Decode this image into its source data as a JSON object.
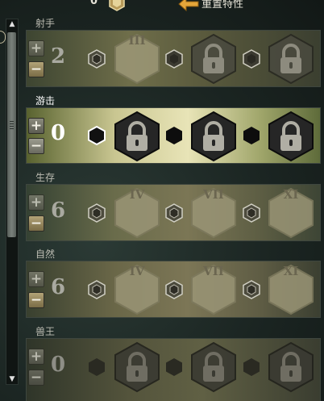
{
  "header": {
    "points_available": "0",
    "reset_label": "重置特性"
  },
  "rows": [
    {
      "title": "射手",
      "points": "2",
      "slots": [
        {
          "kind": "numeral",
          "label": "III"
        },
        {
          "kind": "locked",
          "label": ""
        },
        {
          "kind": "locked",
          "label": ""
        }
      ]
    },
    {
      "title": "游击",
      "points": "0",
      "slots": [
        {
          "kind": "locked",
          "label": ""
        },
        {
          "kind": "locked",
          "label": ""
        },
        {
          "kind": "locked",
          "label": ""
        }
      ]
    },
    {
      "title": "生存",
      "points": "6",
      "slots": [
        {
          "kind": "numeral",
          "label": "IV"
        },
        {
          "kind": "numeral",
          "label": "VII"
        },
        {
          "kind": "numeral",
          "label": "XI"
        }
      ]
    },
    {
      "title": "自然",
      "points": "6",
      "slots": [
        {
          "kind": "numeral",
          "label": "IV"
        },
        {
          "kind": "numeral",
          "label": "VII"
        },
        {
          "kind": "numeral",
          "label": "XI"
        }
      ]
    },
    {
      "title": "兽王",
      "points": "0",
      "slots": [
        {
          "kind": "locked",
          "label": ""
        },
        {
          "kind": "locked",
          "label": ""
        },
        {
          "kind": "locked",
          "label": ""
        }
      ]
    }
  ],
  "icons": {
    "plus": "+",
    "minus": "−",
    "scroll_up": "▲",
    "scroll_down": "▼"
  },
  "colors": {
    "highlight_text": "#ffffff",
    "dim_text": "#a9a9a0",
    "reset_arrow": "#e4a53a"
  }
}
